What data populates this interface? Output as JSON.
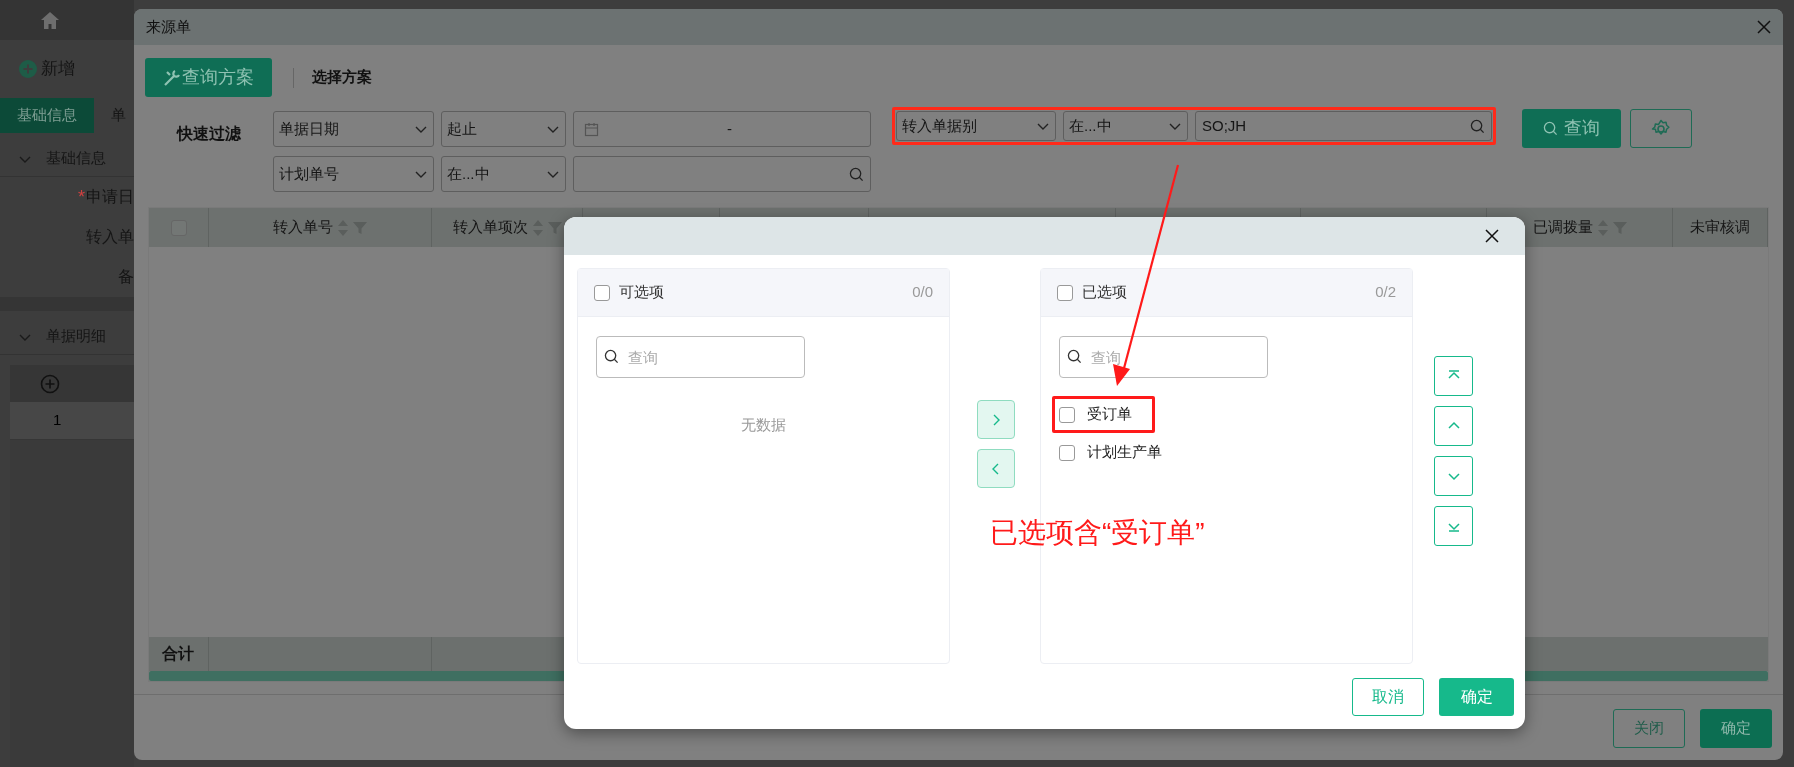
{
  "app": {
    "add_button": "新增",
    "tabs": [
      {
        "label": "基础信息",
        "selected": true
      },
      {
        "label": "单",
        "selected": false
      }
    ],
    "sections": [
      {
        "title": "基础信息",
        "expanded": true
      },
      {
        "title": "单据明细",
        "expanded": true
      }
    ],
    "fields": [
      {
        "label": "申请日",
        "required_mark": "*"
      },
      {
        "label": "转入单"
      },
      {
        "label": "备"
      }
    ],
    "detail_rows": [
      "1"
    ]
  },
  "dialog": {
    "title": "来源单",
    "scheme_button": "查询方案",
    "scheme_label": "选择方案",
    "filter_label": "快速过滤",
    "filters": [
      {
        "kind": "date",
        "field": "单据日期",
        "operator": "起止",
        "value": "-",
        "highlighted": false
      },
      {
        "kind": "text",
        "field": "转入单据别",
        "operator": "在...中",
        "value": "SO;JH",
        "highlighted": true
      },
      {
        "kind": "text",
        "field": "计划单号",
        "operator": "在...中",
        "highlighted": false
      }
    ],
    "query_button": "查询",
    "table": {
      "select_all": false,
      "columns": [
        {
          "label": "转入单号",
          "sortable": true
        },
        {
          "label": "转入单项次",
          "sortable": true
        },
        {
          "label": "已调拨量",
          "sortable": true
        },
        {
          "label": "未审核调",
          "sortable": false
        }
      ],
      "total_label": "合计"
    },
    "buttons": [
      "关闭",
      "确定"
    ]
  },
  "transfer": {
    "source": {
      "title": "可选项",
      "checked": false,
      "count": "0/0",
      "search_placeholder": "查询",
      "empty_text": "无数据"
    },
    "target": {
      "title": "已选项",
      "checked": false,
      "count": "0/2",
      "search_placeholder": "查询",
      "items": [
        {
          "label": "受订单",
          "checked": false,
          "highlighted": true
        },
        {
          "label": "计划生产单",
          "checked": false,
          "highlighted": false
        }
      ]
    },
    "buttons": [
      "取消",
      "确定"
    ]
  },
  "annotation": {
    "text": "已选项含“受订单”"
  }
}
